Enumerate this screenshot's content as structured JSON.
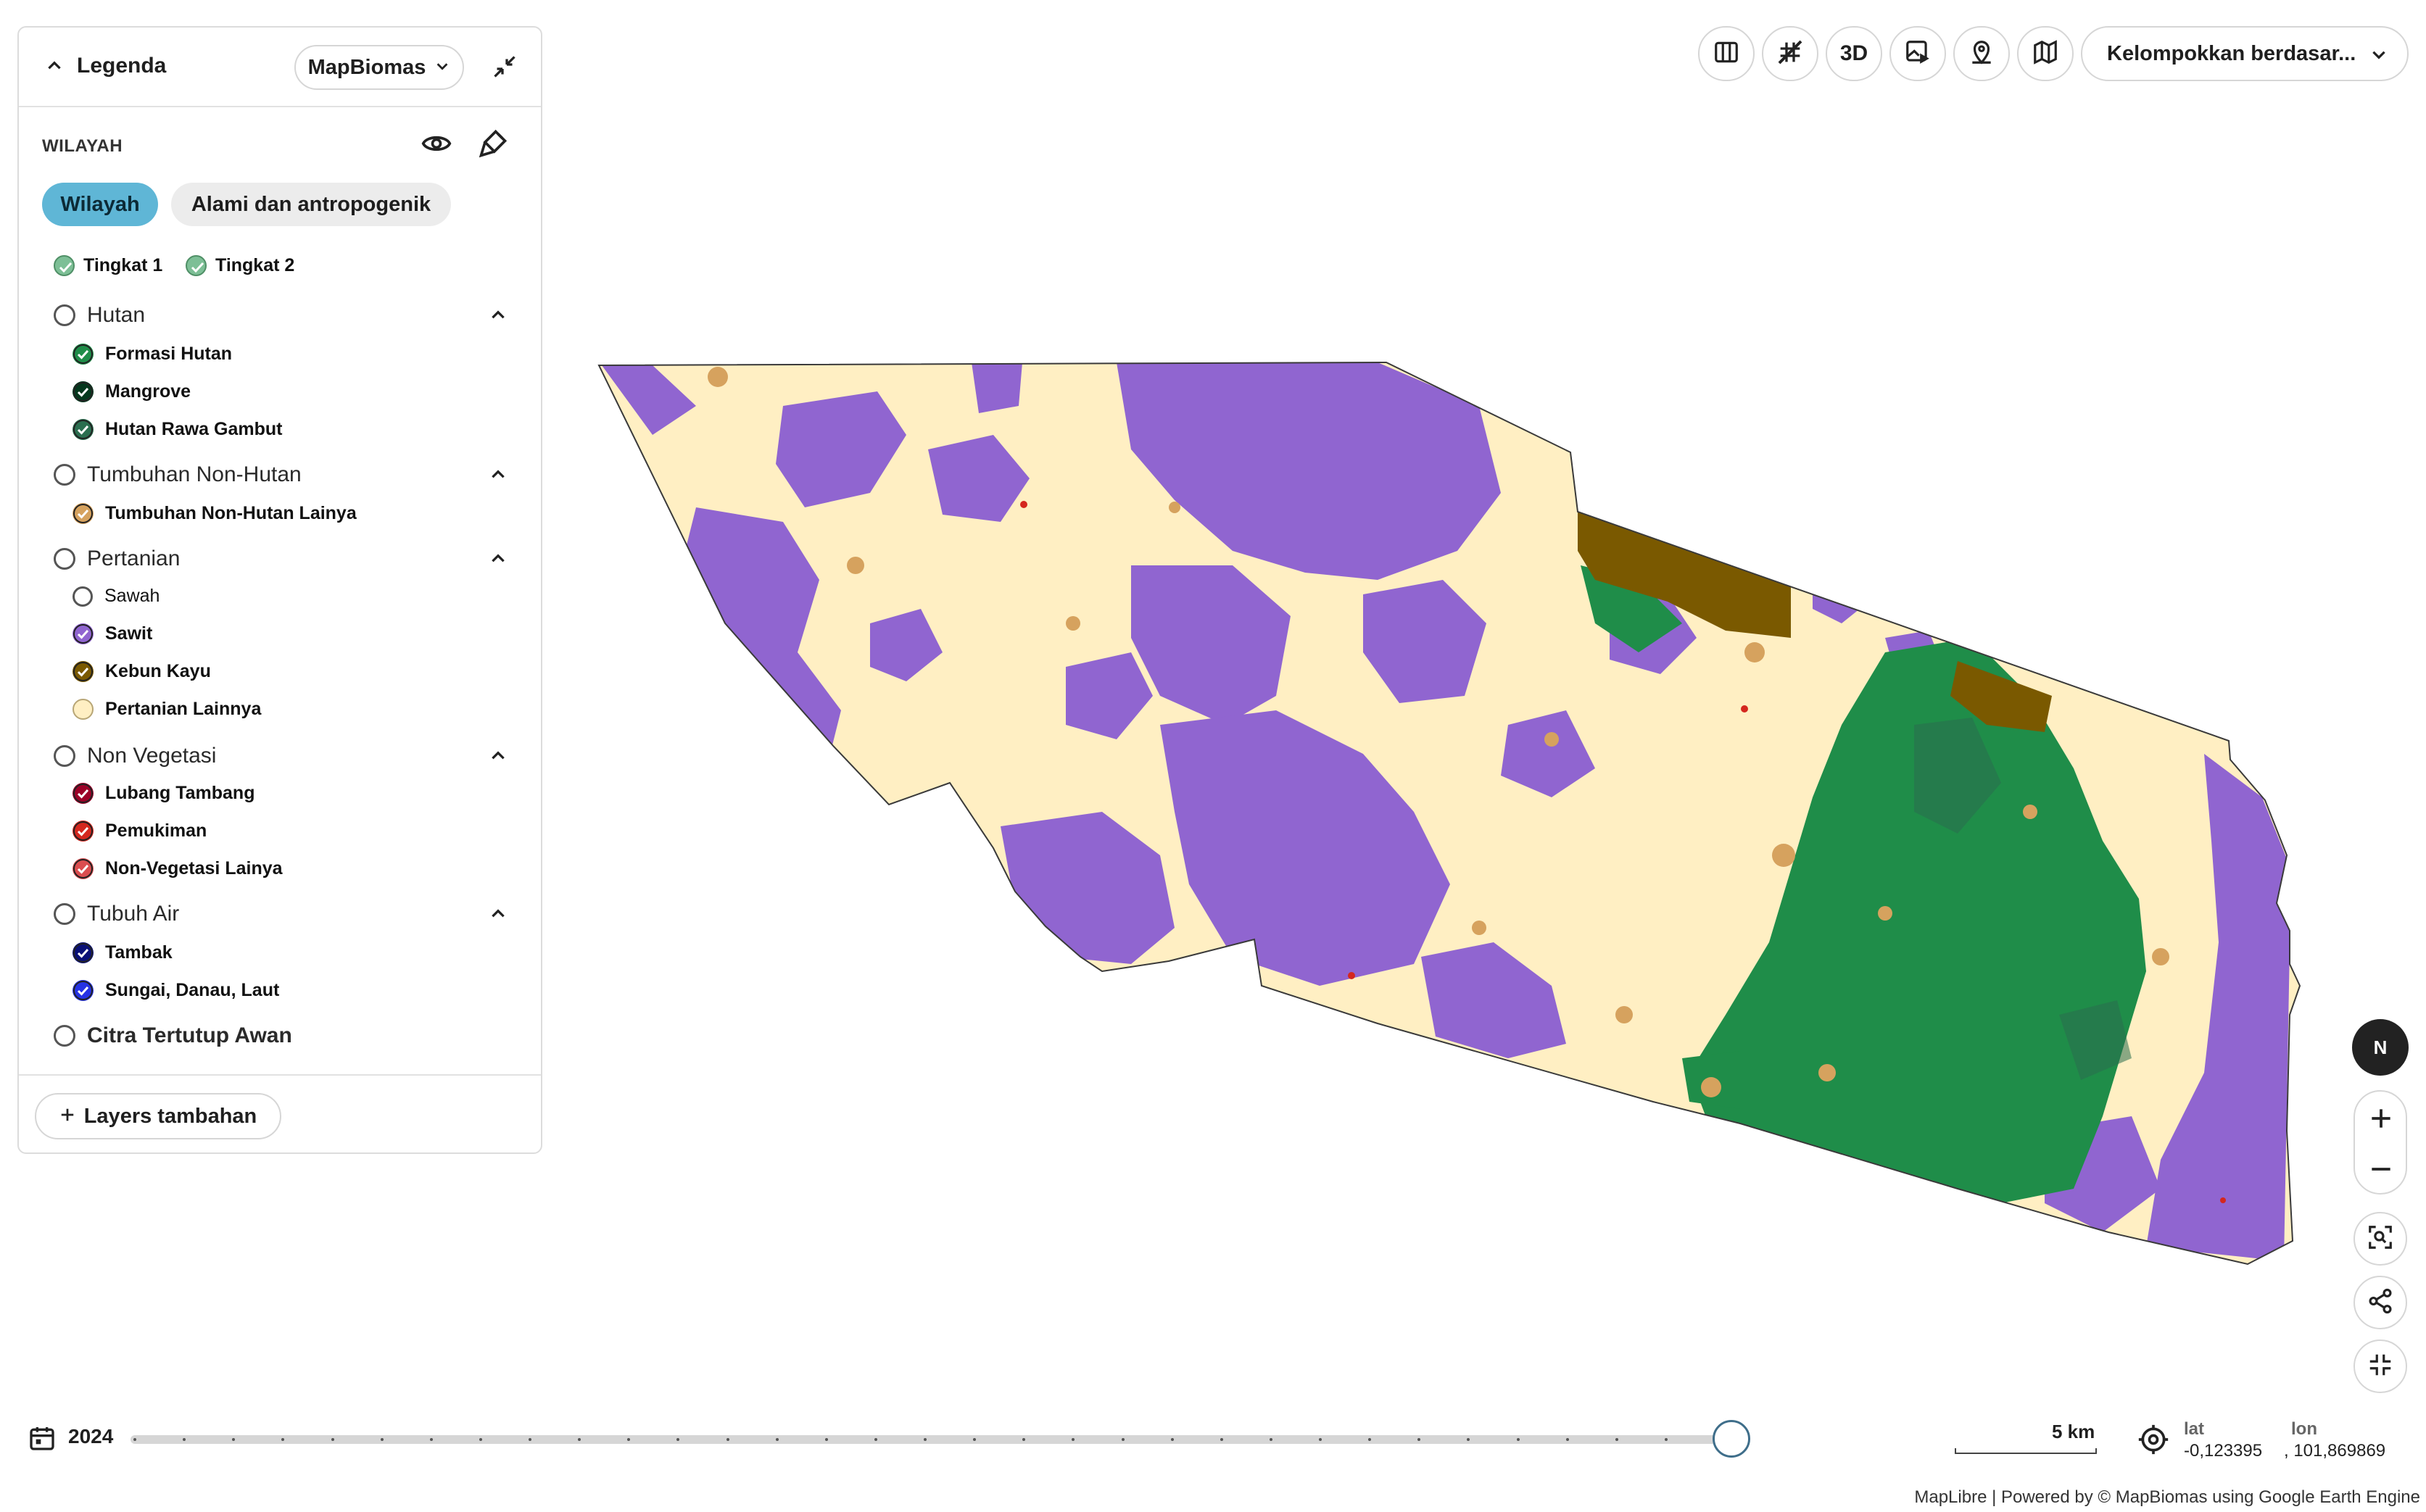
{
  "legend": {
    "title": "Legenda",
    "source_select": "MapBiomas",
    "section_title": "WILAYAH",
    "tabs": [
      {
        "label": "Wilayah",
        "active": true
      },
      {
        "label": "Alami dan antropogenik",
        "active": false
      }
    ],
    "levels": [
      "Tingkat 1",
      "Tingkat 2"
    ],
    "categories": [
      {
        "label": "Hutan",
        "items": [
          {
            "label": "Formasi Hutan",
            "color": "#1f8d49"
          },
          {
            "label": "Mangrove",
            "color": "#04381d"
          },
          {
            "label": "Hutan Rawa Gambut",
            "color": "#2a6e4f"
          }
        ]
      },
      {
        "label": "Tumbuhan Non-Hutan",
        "items": [
          {
            "label": "Tumbuhan Non-Hutan Lainya",
            "color": "#d6a25e"
          }
        ]
      },
      {
        "label": "Pertanian",
        "items": [
          {
            "label": "Sawah",
            "color": null
          },
          {
            "label": "Sawit",
            "color": "#9065d0"
          },
          {
            "label": "Kebun Kayu",
            "color": "#7a5900"
          },
          {
            "label": "Pertanian Lainnya",
            "color": "#ffefc3"
          }
        ]
      },
      {
        "label": "Non Vegetasi",
        "items": [
          {
            "label": "Lubang Tambang",
            "color": "#9c0027"
          },
          {
            "label": "Pemukiman",
            "color": "#d4271e"
          },
          {
            "label": "Non-Vegetasi Lainya",
            "color": "#db4d4f"
          }
        ]
      },
      {
        "label": "Tubuh Air",
        "items": [
          {
            "label": "Tambak",
            "color": "#091077"
          },
          {
            "label": "Sungai, Danau, Laut",
            "color": "#2532e4"
          }
        ]
      }
    ],
    "cloud_label": "Citra Tertutup Awan",
    "add_layers": "Layers tambahan"
  },
  "toolbar": {
    "three_d": "3D",
    "group_select": "Kelompokkan berdasar..."
  },
  "map_controls": {
    "compass": "N"
  },
  "timeline": {
    "year": "2024"
  },
  "scale": {
    "label": "5 km"
  },
  "coords": {
    "lat_label": "lat",
    "lat": "-0,123395",
    "lon_label": "lon",
    "lon": ", 101,869869"
  },
  "attribution": "MapLibre | Powered by © MapBiomas using Google Earth Engine",
  "colors": {
    "accent": "#5fb6d6",
    "sawit": "#9065d0",
    "pertanian_lainnya": "#ffefc3",
    "formasi_hutan": "#1f8d49",
    "kebun_kayu": "#7a5900",
    "tumbuhan_non_hutan": "#d6a25e"
  }
}
